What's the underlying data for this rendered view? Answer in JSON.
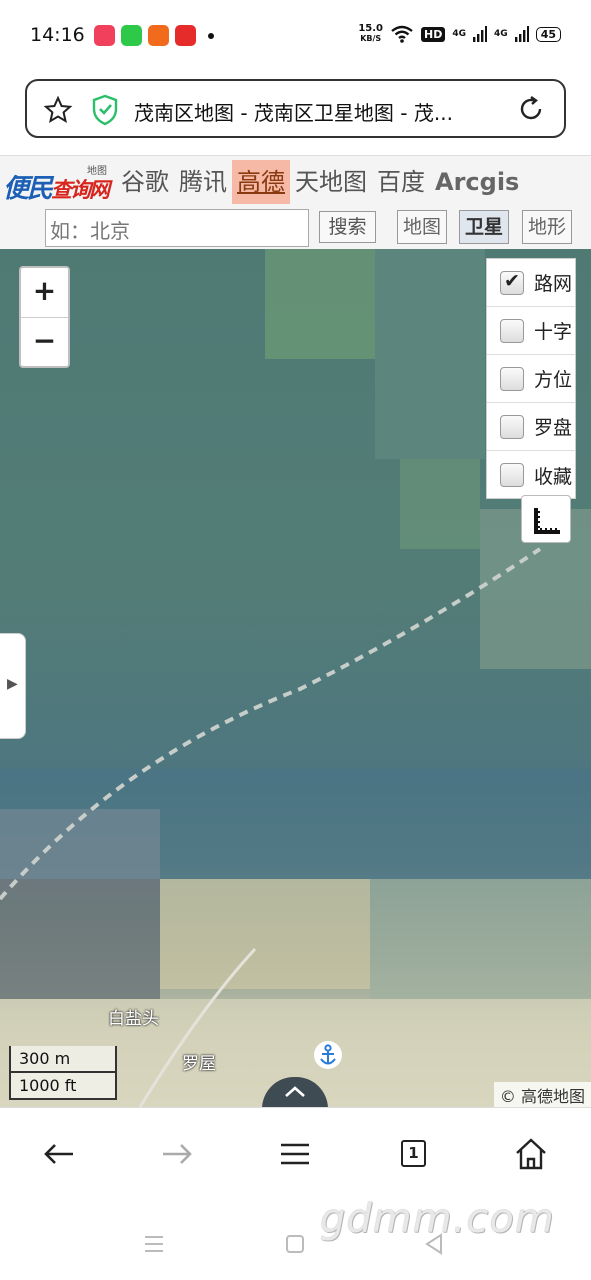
{
  "status_bar": {
    "time": "14:16",
    "net_speed_value": "15.0",
    "net_speed_unit": "KB/S",
    "hd_badge": "HD",
    "signal_1": "4G",
    "signal_2": "4G",
    "battery": "45"
  },
  "browser": {
    "page_title": "茂南区地图 - 茂南区卫星地图 - 茂..."
  },
  "site": {
    "logo_main_1": "便民",
    "logo_main_2": "查询网",
    "logo_sub": "地图",
    "providers": [
      "谷歌",
      "腾讯",
      "高德",
      "天地图",
      "百度",
      "Arcgis"
    ],
    "active_provider": "高德",
    "search_placeholder": "如：北京",
    "search_button": "搜索",
    "map_types": [
      "地图",
      "卫星",
      "地形"
    ],
    "active_map_type": "卫星"
  },
  "map": {
    "zoom_in": "+",
    "zoom_out": "−",
    "layers": [
      {
        "label": "路网",
        "checked": true
      },
      {
        "label": "十字",
        "checked": false
      },
      {
        "label": "方位",
        "checked": false
      },
      {
        "label": "罗盘",
        "checked": false
      },
      {
        "label": "收藏",
        "checked": false
      }
    ],
    "place_labels": [
      "白盐头",
      "罗屋"
    ],
    "scale_metric": "300 m",
    "scale_imperial": "1000 ft",
    "attribution": "© 高德地图"
  },
  "toolbar": {
    "tab_count": "1"
  },
  "watermark": "gdmm.com",
  "colors": {
    "active_provider_bg": "#f5b9a6",
    "logo_blue": "#1c5fb5",
    "logo_red": "#d8251d",
    "shield_green": "#2bbf6a"
  }
}
